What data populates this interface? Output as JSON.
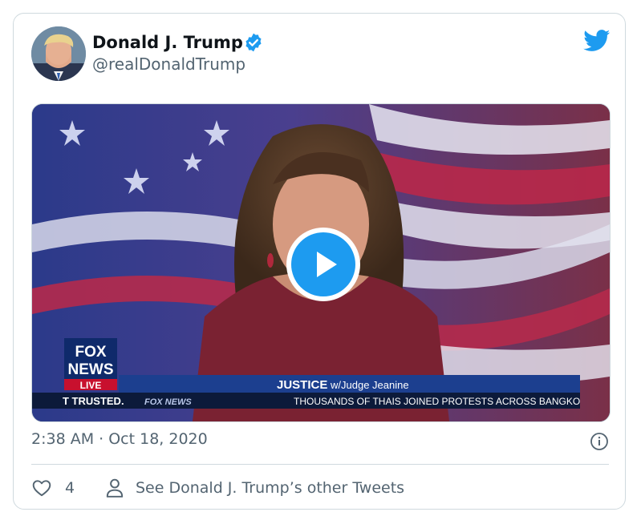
{
  "author": {
    "name": "Donald J. Trump",
    "handle": "@realDonaldTrump"
  },
  "media": {
    "overlay": {
      "network_logo_line1": "FOX",
      "network_logo_line2": "NEWS",
      "live_label": "LIVE",
      "show_title": "JUSTICE",
      "show_subtitle": "w/Judge Jeanine",
      "ticker_left": "T TRUSTED.",
      "ticker_brand": "FOX NEWS",
      "ticker_text": "THOUSANDS OF THAIS JOINED PROTESTS ACROSS BANGKO"
    }
  },
  "tweet": {
    "timestamp": "2:38 AM · Oct 18, 2020",
    "like_count": "4",
    "other_tweets_label": "See Donald J. Trump’s other Tweets"
  },
  "colors": {
    "twitter_blue": "#1d9bf0",
    "text_primary": "#0f1419",
    "text_secondary": "#536471",
    "border": "#cfd9de"
  },
  "icons": {
    "verified": "verified-badge-icon",
    "brand": "twitter-bird-icon",
    "play": "play-icon",
    "info": "info-icon",
    "like": "heart-icon",
    "profile": "person-icon"
  }
}
